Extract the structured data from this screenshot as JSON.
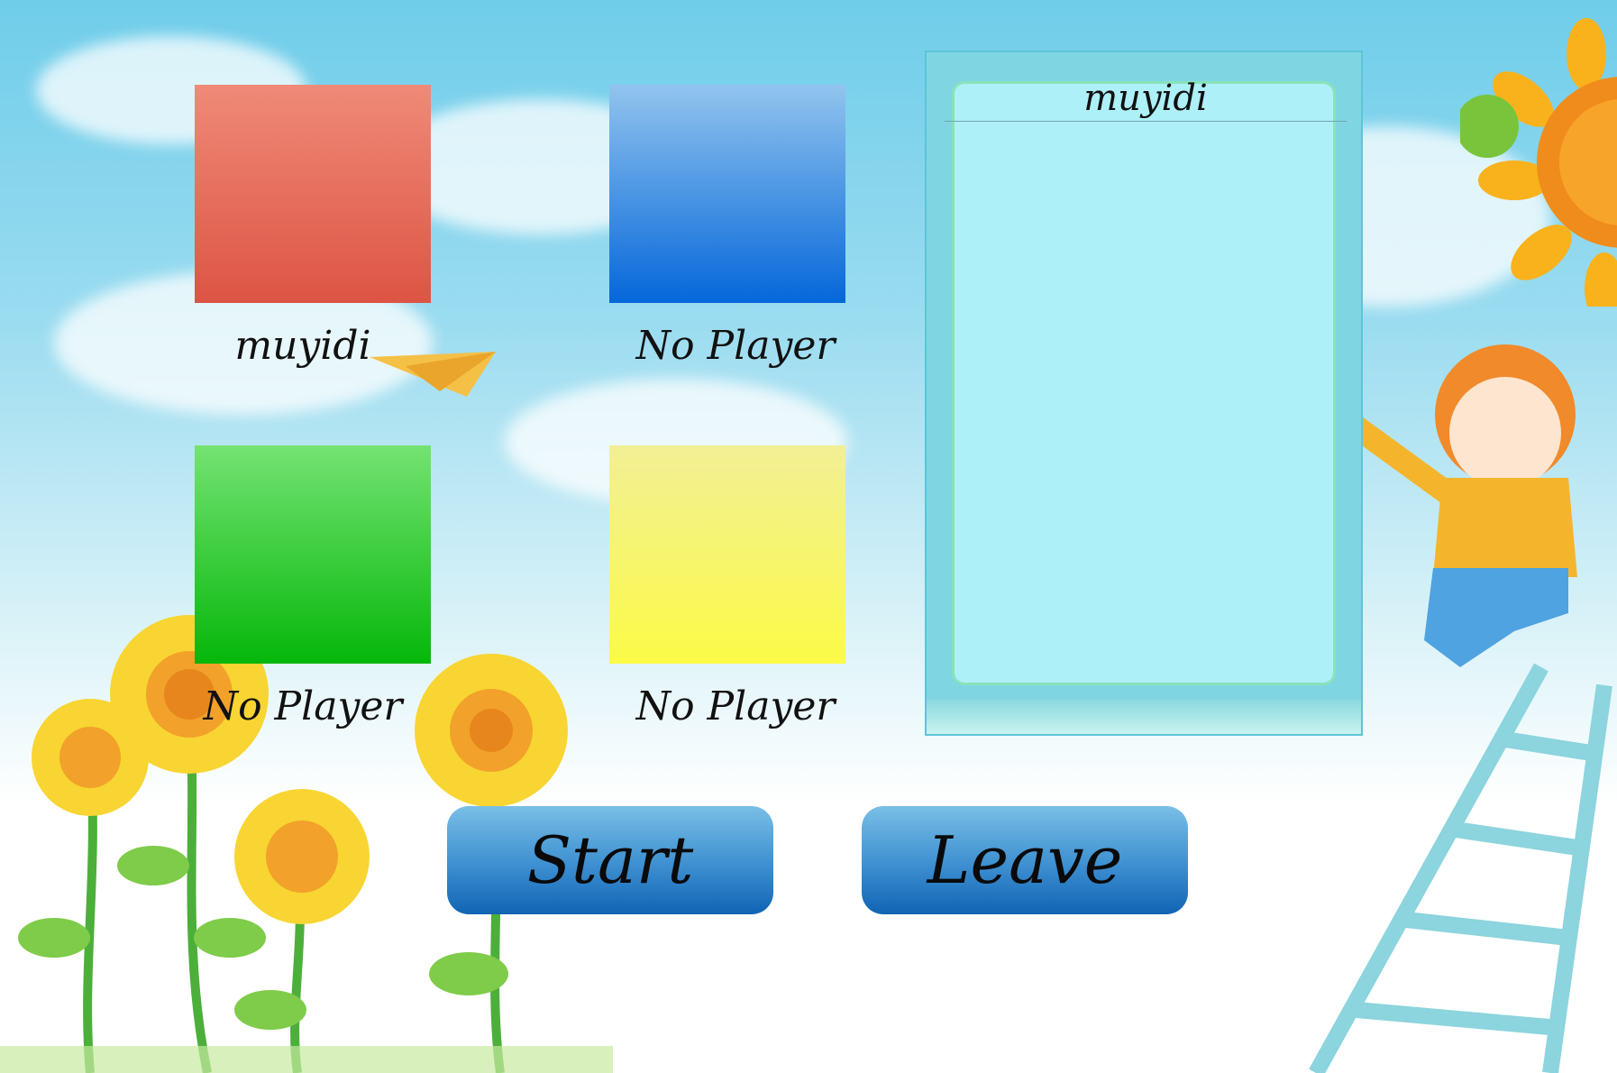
{
  "players": [
    {
      "color": "red",
      "name": "muyidi"
    },
    {
      "color": "blue",
      "name": "No Player"
    },
    {
      "color": "green",
      "name": "No Player"
    },
    {
      "color": "yellow",
      "name": "No Player"
    }
  ],
  "chat_panel": {
    "title": "muyidi"
  },
  "buttons": {
    "start": "Start",
    "leave": "Leave"
  },
  "colors": {
    "red": "#dd5444",
    "blue": "#0567da",
    "green": "#05b70a",
    "yellow": "#fbfb47",
    "button": "#3d8fd1"
  },
  "decorations": [
    "paper-plane-icon",
    "sunflower-icon",
    "boy-on-ladder-illustration",
    "sun-icon"
  ]
}
